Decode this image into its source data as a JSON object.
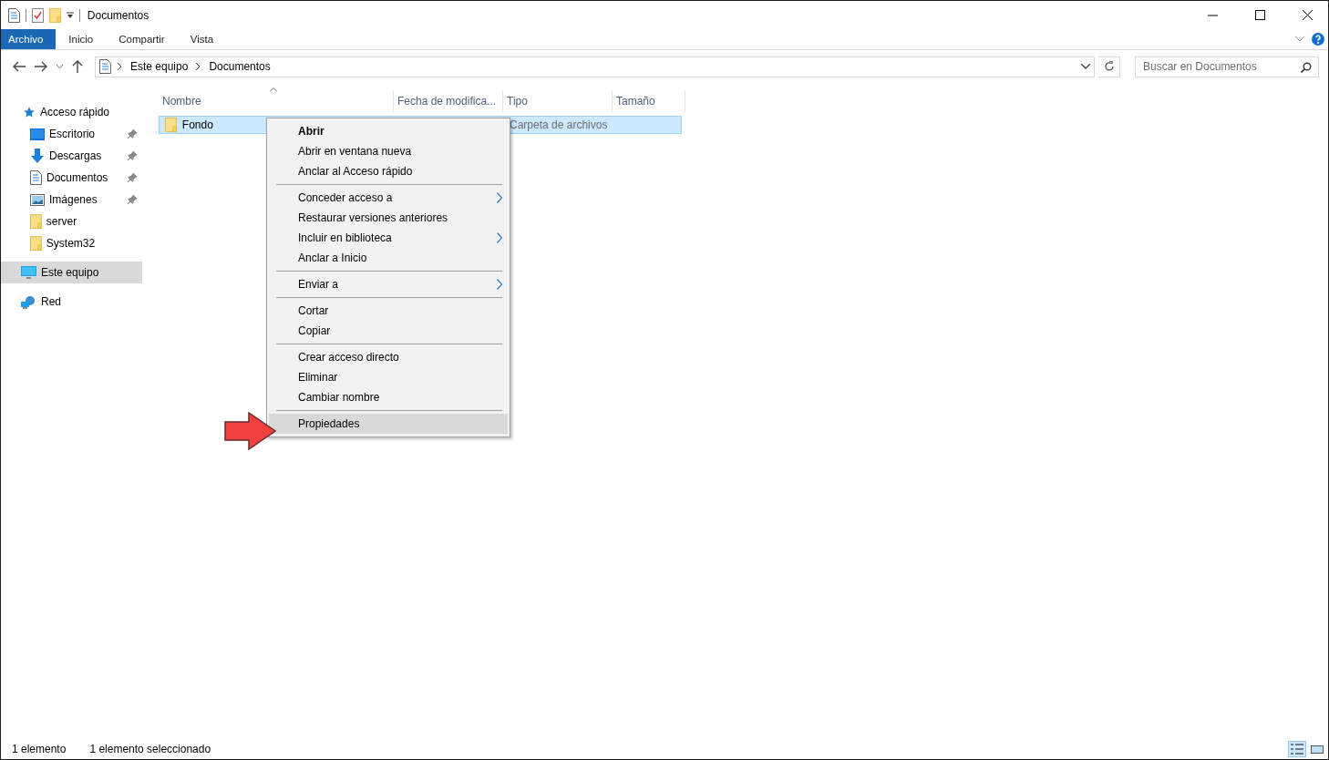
{
  "window": {
    "title": "Documentos"
  },
  "ribbon": {
    "tabs": [
      {
        "label": "Archivo",
        "selected": true
      },
      {
        "label": "Inicio",
        "selected": false
      },
      {
        "label": "Compartir",
        "selected": false
      },
      {
        "label": "Vista",
        "selected": false
      }
    ]
  },
  "address_bar": {
    "path": [
      "Este equipo",
      "Documentos"
    ],
    "search": {
      "placeholder": "Buscar en Documentos"
    }
  },
  "sidebar": {
    "items": [
      {
        "label": "Acceso rápido",
        "kind": "star",
        "selected": false,
        "children": [
          {
            "label": "Escritorio",
            "kind": "desktop",
            "pinned": true,
            "selected": false
          },
          {
            "label": "Descargas",
            "kind": "download",
            "pinned": true,
            "selected": false
          },
          {
            "label": "Documentos",
            "kind": "document",
            "pinned": true,
            "selected": false
          },
          {
            "label": "Imágenes",
            "kind": "pictures",
            "pinned": true,
            "selected": false
          },
          {
            "label": "server",
            "kind": "folder",
            "pinned": false,
            "selected": false
          },
          {
            "label": "System32",
            "kind": "folder",
            "pinned": false,
            "selected": false
          }
        ]
      },
      {
        "label": "Este equipo",
        "kind": "computer",
        "selected": true
      },
      {
        "label": "Red",
        "kind": "network",
        "selected": false
      }
    ]
  },
  "table": {
    "columns": [
      {
        "label": "Nombre",
        "sorted": true
      },
      {
        "label": "Fecha de modifica...",
        "sorted": false
      },
      {
        "label": "Tipo",
        "sorted": false
      },
      {
        "label": "Tamaño",
        "sorted": false
      }
    ],
    "rows": [
      {
        "name": "Fondo",
        "type": "Carpeta de archivos",
        "selected": true
      }
    ]
  },
  "context_menu": {
    "items": [
      {
        "kind": "item",
        "label": "Abrir",
        "bold": true,
        "submenu": false,
        "selected": false
      },
      {
        "kind": "item",
        "label": "Abrir en ventana nueva",
        "bold": false,
        "submenu": false,
        "selected": false
      },
      {
        "kind": "item",
        "label": "Anclar al Acceso rápido",
        "bold": false,
        "submenu": false,
        "selected": false
      },
      {
        "kind": "separator"
      },
      {
        "kind": "item",
        "label": "Conceder acceso a",
        "bold": false,
        "submenu": true,
        "selected": false
      },
      {
        "kind": "item",
        "label": "Restaurar versiones anteriores",
        "bold": false,
        "submenu": false,
        "selected": false
      },
      {
        "kind": "item",
        "label": "Incluir en biblioteca",
        "bold": false,
        "submenu": true,
        "selected": false
      },
      {
        "kind": "item",
        "label": "Anclar a Inicio",
        "bold": false,
        "submenu": false,
        "selected": false
      },
      {
        "kind": "separator"
      },
      {
        "kind": "item",
        "label": "Enviar a",
        "bold": false,
        "submenu": true,
        "selected": false
      },
      {
        "kind": "separator"
      },
      {
        "kind": "item",
        "label": "Cortar",
        "bold": false,
        "submenu": false,
        "selected": false
      },
      {
        "kind": "item",
        "label": "Copiar",
        "bold": false,
        "submenu": false,
        "selected": false
      },
      {
        "kind": "separator"
      },
      {
        "kind": "item",
        "label": "Crear acceso directo",
        "bold": false,
        "submenu": false,
        "selected": false
      },
      {
        "kind": "item",
        "label": "Eliminar",
        "bold": false,
        "submenu": false,
        "selected": false
      },
      {
        "kind": "item",
        "label": "Cambiar nombre",
        "bold": false,
        "submenu": false,
        "selected": false
      },
      {
        "kind": "separator"
      },
      {
        "kind": "item",
        "label": "Propiedades",
        "bold": false,
        "submenu": false,
        "selected": true
      }
    ]
  },
  "status_bar": {
    "items": [
      "1 elemento",
      "1 elemento seleccionado"
    ]
  }
}
